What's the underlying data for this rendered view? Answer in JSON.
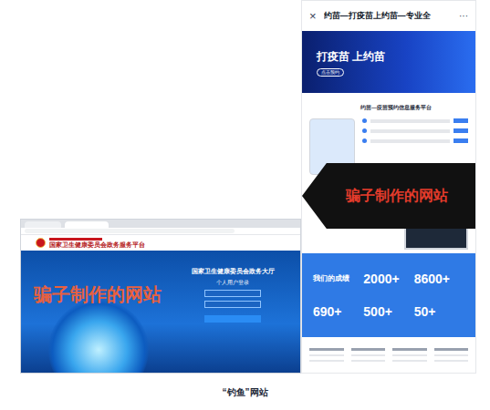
{
  "caption": "“钓鱼”网站",
  "left_site": {
    "header_title": "国家卫生健康委员会政务服务平台",
    "overlay": "骗子制作的网站",
    "login_title": "国家卫生健康委员会政务大厅",
    "login_subtitle": "个人用户登录"
  },
  "right_site": {
    "close": "×",
    "title": "约苗—打疫苗上约苗—专业全",
    "more": "···",
    "banner_title": "打疫苗 上约苗",
    "banner_button": "点击预约",
    "intro_title": "约苗—疫苗预约信息服务平台",
    "overlay": "骗子制作的网站",
    "stats_title": "我们的成绩",
    "stats": [
      "2000+",
      "8600+",
      "690+",
      "500+",
      "50+"
    ]
  }
}
